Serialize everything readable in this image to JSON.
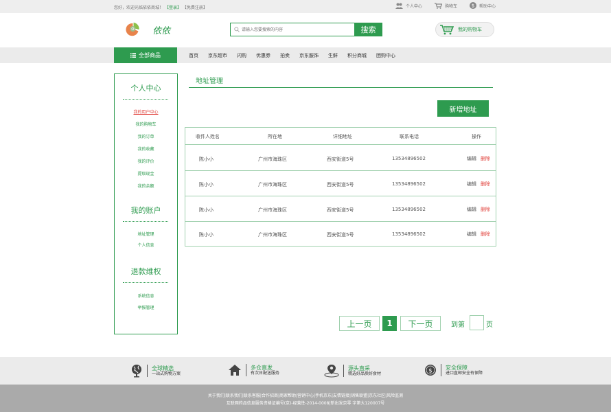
{
  "topbar": {
    "welcome": "您好，欢迎光临依依商城！",
    "login": "【登录】",
    "register": "【免费注册】",
    "links": [
      "个人中心",
      "购物车",
      "帮助中心"
    ]
  },
  "header": {
    "logo_text": "依依",
    "search_placeholder": "请输入您要搜索的内容",
    "search_button": "搜索",
    "cart": "我的购物车"
  },
  "nav": {
    "all_categories": "全部商品",
    "items": [
      "首页",
      "京东超市",
      "闪购",
      "优惠券",
      "拍卖",
      "京东服饰",
      "生鲜",
      "积分商城",
      "团购中心"
    ]
  },
  "sidebar": {
    "sections": [
      {
        "title": "个人中心",
        "items": [
          "我的用户中心",
          "我的购物车",
          "我的订单",
          "我的收藏",
          "我的评价",
          "提取现金",
          "我的余额"
        ]
      },
      {
        "title": "我的账户",
        "items": [
          "地址管理",
          "个人信息"
        ]
      },
      {
        "title": "退款维权",
        "items": [
          "系统信息",
          "举报管理"
        ]
      }
    ]
  },
  "main": {
    "title": "地址管理",
    "new_button": "新增地址",
    "columns": [
      "收件人姓名",
      "所在地",
      "详细地址",
      "联系电话",
      "操作"
    ],
    "rows": [
      {
        "name": "陈小小",
        "region": "广州市海珠区",
        "address": "西安街道5号",
        "phone": "13534896502",
        "edit": "编辑",
        "delete": "删除"
      },
      {
        "name": "陈小小",
        "region": "广州市海珠区",
        "address": "西安街道5号",
        "phone": "13534896502",
        "edit": "编辑",
        "delete": "删除"
      },
      {
        "name": "陈小小",
        "region": "广州市海珠区",
        "address": "西安街道5号",
        "phone": "13534896502",
        "edit": "编辑",
        "delete": "删除"
      },
      {
        "name": "陈小小",
        "region": "广州市海珠区",
        "address": "西安街道5号",
        "phone": "13534896502",
        "edit": "编辑",
        "delete": "删除"
      }
    ]
  },
  "pagination": {
    "prev": "上一页",
    "current": "1",
    "next": "下一页",
    "goto_prefix": "到第",
    "goto_suffix": "页"
  },
  "features": [
    {
      "title": "全球精选",
      "sub": "一站式购物方案",
      "icon": "globe-icon"
    },
    {
      "title": "多仓直发",
      "sub": "有次日配送服务",
      "icon": "house-icon"
    },
    {
      "title": "源头直采",
      "sub": "精选好品质好食材",
      "icon": "location-pin-icon"
    },
    {
      "title": "安全保障",
      "sub": "进口直邮安全有保障",
      "icon": "dollar-coin-icon"
    }
  ],
  "footer": {
    "line1": "关于我们|联系我们|联系客服|合作招商|商家帮助|营销中心|手机京东|友情链接|销售联盟|京东社区|风险监测",
    "line2": "互联网药品信息服务资格证编号(京)-经营性-2014-0008|新出发京零 字第大120007号"
  },
  "colors": {
    "accent": "#2e9b4f",
    "danger": "#e0403a"
  }
}
